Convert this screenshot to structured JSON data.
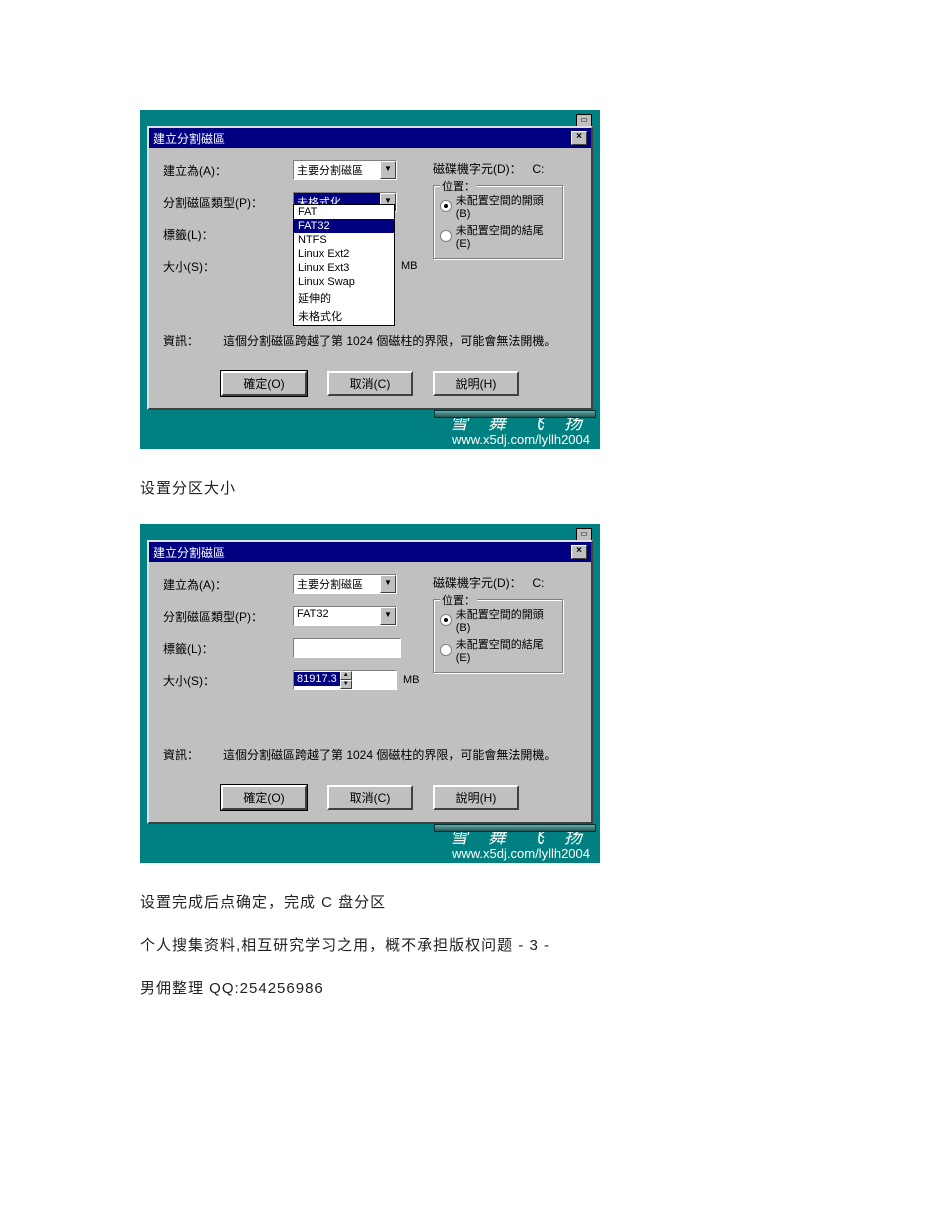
{
  "dialog": {
    "title": "建立分割磁區",
    "labels": {
      "create_as": "建立為(A)：",
      "partition_type": "分割磁區類型(P)：",
      "label": "標籤(L)：",
      "size": "大小(S)：",
      "drive_letter": "磁碟機字元(D)：",
      "position_group": "位置：",
      "position_begin": "未配置空間的開頭(B)",
      "position_end": "未配置空間的結尾(E)",
      "info": "資訊：",
      "size_unit": "MB"
    },
    "buttons": {
      "ok": "確定(O)",
      "cancel": "取消(C)",
      "help": "說明(H)"
    },
    "info_text": "這個分割磁區跨越了第 1024 個磁柱的界限，可能會無法開機。",
    "create_as_value": "主要分割磁區",
    "drive_letter_value": "C:",
    "watermark_cn": [
      "雪",
      "舞",
      "飞",
      "扬"
    ],
    "watermark_url": "www.x5dj.com/lyllh2004"
  },
  "shot1": {
    "type_value": "未格式化",
    "dropdown_options": [
      "FAT",
      "FAT32",
      "NTFS",
      "Linux Ext2",
      "Linux Ext3",
      "Linux Swap",
      "延伸的",
      "未格式化"
    ],
    "dropdown_highlight_index": 1
  },
  "shot2": {
    "type_value": "FAT32",
    "label_value": "",
    "size_value": "81917.3"
  },
  "captions": {
    "after_shot1": "设置分区大小",
    "after_shot2": "设置完成后点确定，完成 C 盘分区",
    "footer1": "个人搜集资料,相互研究学习之用，概不承担版权问题 - 3 -",
    "footer2": "男佣整理 QQ:254256986"
  }
}
